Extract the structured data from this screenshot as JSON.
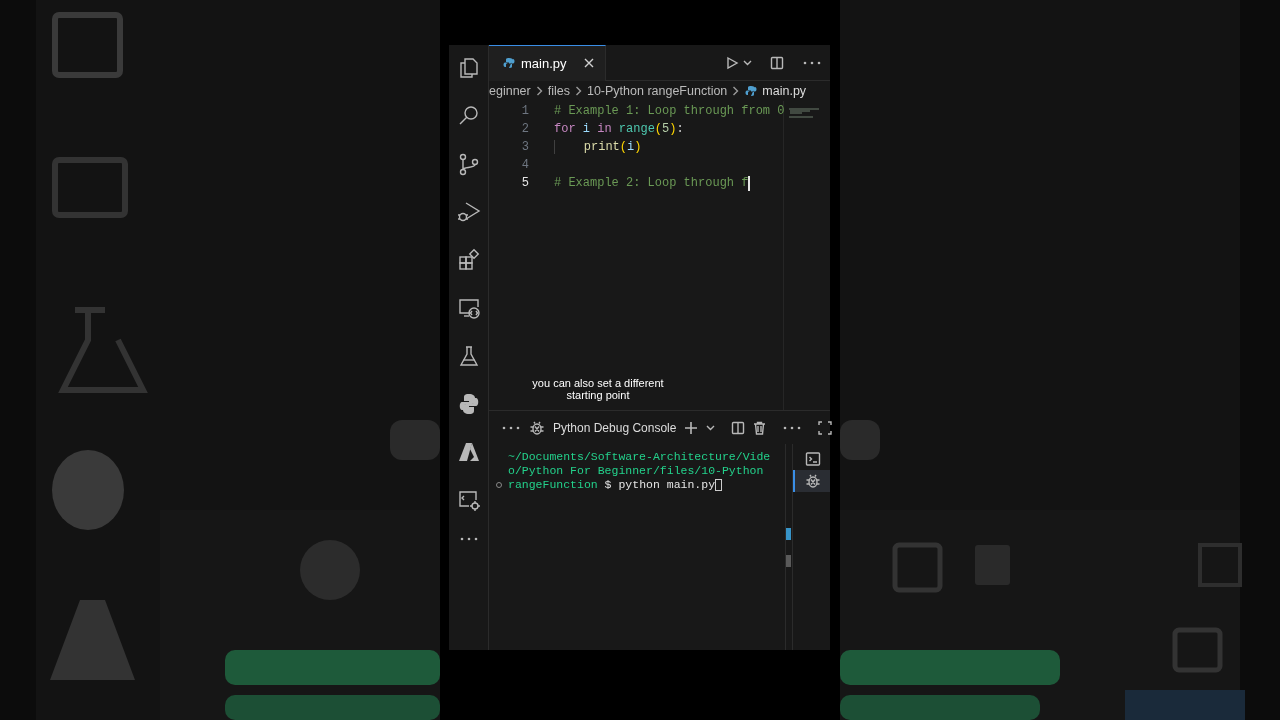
{
  "tab": {
    "label": "main.py",
    "selected": true
  },
  "breadcrumbs": [
    "eginner",
    "files",
    "10-Python rangeFunction",
    "main.py"
  ],
  "code_lines": [
    {
      "number": "1",
      "current": false,
      "tokens": [
        {
          "kind": "comment",
          "text": "# Example 1: Loop through from 0"
        }
      ]
    },
    {
      "number": "2",
      "current": false,
      "tokens": [
        {
          "kind": "keyword",
          "text": "for"
        },
        {
          "kind": "variable",
          "text": "i",
          "spaced": true
        },
        {
          "kind": "keyword",
          "text": "in",
          "spaced": true
        },
        {
          "kind": "builtin",
          "text": "range",
          "spaced": true
        },
        {
          "kind": "bracket",
          "text": "("
        },
        {
          "kind": "number",
          "text": "5"
        },
        {
          "kind": "bracket",
          "text": ")"
        },
        {
          "kind": "plain",
          "text": ":"
        }
      ]
    },
    {
      "number": "3",
      "current": false,
      "indented": true,
      "tokens": [
        {
          "kind": "function",
          "text": "print"
        },
        {
          "kind": "bracket",
          "text": "("
        },
        {
          "kind": "variable",
          "text": "i"
        },
        {
          "kind": "bracket",
          "text": ")"
        }
      ]
    },
    {
      "number": "4",
      "current": false
    },
    {
      "number": "5",
      "current": true,
      "tokens": [
        {
          "kind": "comment",
          "text": "# Example 2: Loop through f"
        }
      ]
    }
  ],
  "caption": "you can also set a different starting point",
  "panel": {
    "title": "Python Debug Console",
    "terminal_lines": [
      {
        "marker": false,
        "tokens": [
          {
            "kind": "path",
            "text": "~/Documents/Software-Architecture/Vide"
          }
        ]
      },
      {
        "marker": false,
        "tokens": [
          {
            "kind": "path",
            "text": "o/Python For Beginner/files/10-Python"
          }
        ]
      },
      {
        "marker": true,
        "tokens": [
          {
            "kind": "path",
            "text": "rangeFunction"
          },
          {
            "kind": "command",
            "text": " $ python main.py"
          }
        ]
      }
    ],
    "terminals": [
      {
        "kind": "shell",
        "selected": false
      },
      {
        "kind": "debug",
        "selected": true
      }
    ]
  }
}
